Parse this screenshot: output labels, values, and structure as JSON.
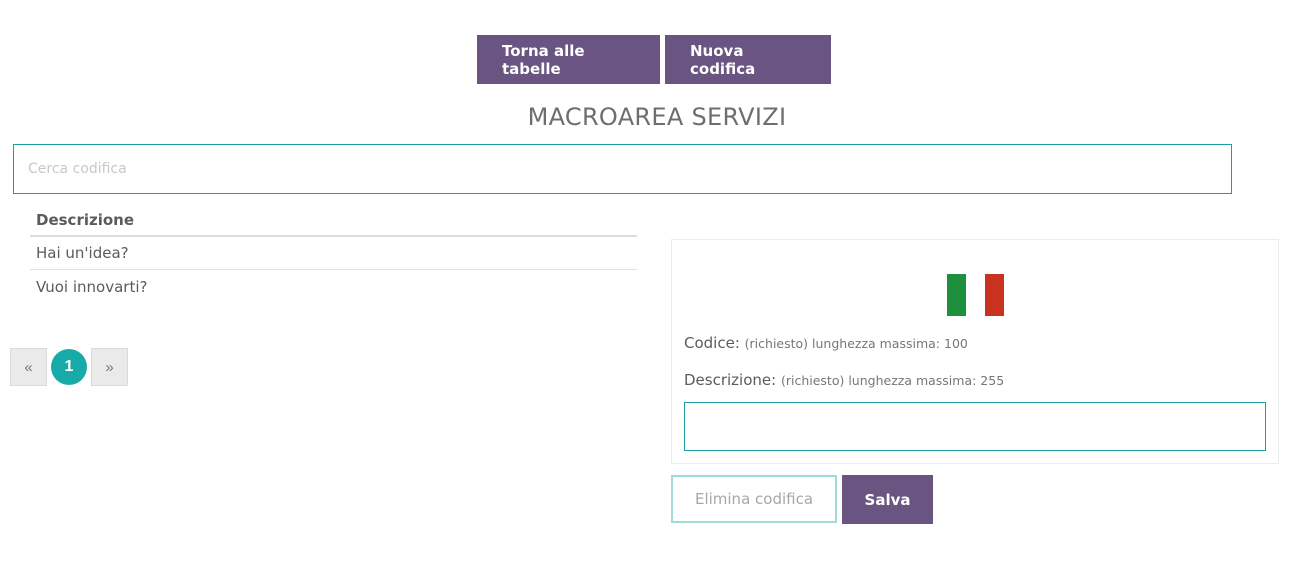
{
  "toolbar": {
    "back_label": "Torna alle tabelle",
    "new_label": "Nuova codifica"
  },
  "page": {
    "title": "MACROAREA SERVIZI"
  },
  "search": {
    "placeholder": "Cerca codifica",
    "value": ""
  },
  "table": {
    "header": "Descrizione",
    "rows": [
      "Hai un'idea?",
      "Vuoi innovarti?"
    ]
  },
  "pagination": {
    "prev_label": "«",
    "current_page": "1",
    "next_label": "»"
  },
  "form": {
    "flag_icon": "italy-flag-icon",
    "code_label": "Codice:",
    "code_hint": "(richiesto) lunghezza massima: 100",
    "desc_label": "Descrizione:",
    "desc_hint": "(richiesto) lunghezza massima: 255",
    "desc_value": ""
  },
  "actions": {
    "delete_label": "Elimina codifica",
    "save_label": "Salva"
  },
  "colors": {
    "primary": "#6a5481",
    "accent": "#16aaa8",
    "input_border": "#17a0a8"
  }
}
